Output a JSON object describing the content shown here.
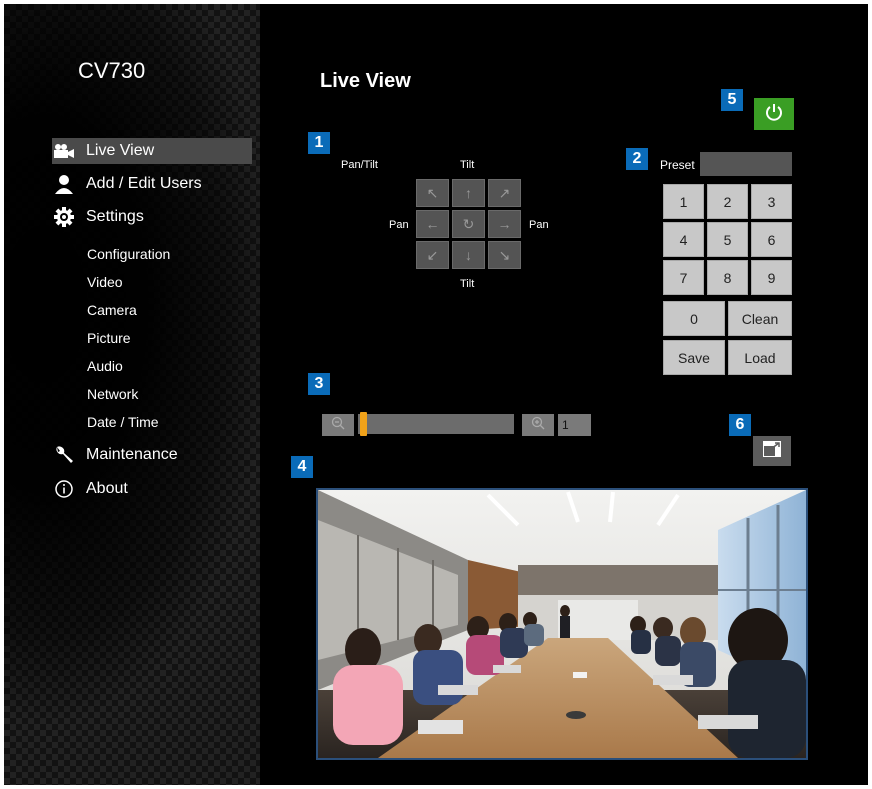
{
  "app": {
    "model": "CV730"
  },
  "nav": {
    "items": [
      {
        "label": "Live View",
        "icon": "video-camera-icon",
        "active": true
      },
      {
        "label": "Add / Edit Users",
        "icon": "user-icon"
      },
      {
        "label": "Settings",
        "icon": "gear-icon"
      },
      {
        "label": "Maintenance",
        "icon": "wrench-icon"
      },
      {
        "label": "About",
        "icon": "info-icon"
      }
    ],
    "settings_sub": [
      "Configuration",
      "Video",
      "Camera",
      "Picture",
      "Audio",
      "Network",
      "Date / Time"
    ]
  },
  "page": {
    "title": "Live View"
  },
  "callouts": [
    "1",
    "2",
    "3",
    "4",
    "5",
    "6"
  ],
  "ptz": {
    "pan_tilt_label": "Pan/Tilt",
    "tilt_label": "Tilt",
    "pan_label": "Pan",
    "buttons": [
      "up-left",
      "up",
      "up-right",
      "left",
      "home",
      "right",
      "down-left",
      "down",
      "down-right"
    ]
  },
  "preset": {
    "label": "Preset",
    "value": "",
    "keys": [
      "1",
      "2",
      "3",
      "4",
      "5",
      "6",
      "7",
      "8",
      "9",
      "0",
      "Clean",
      "Save",
      "Load"
    ]
  },
  "zoom": {
    "value": "1",
    "level_fraction": 0.0
  },
  "colors": {
    "accent_blue": "#0a6bb8",
    "power_green": "#3a9e24",
    "zoom_thumb": "#f0a21a"
  }
}
